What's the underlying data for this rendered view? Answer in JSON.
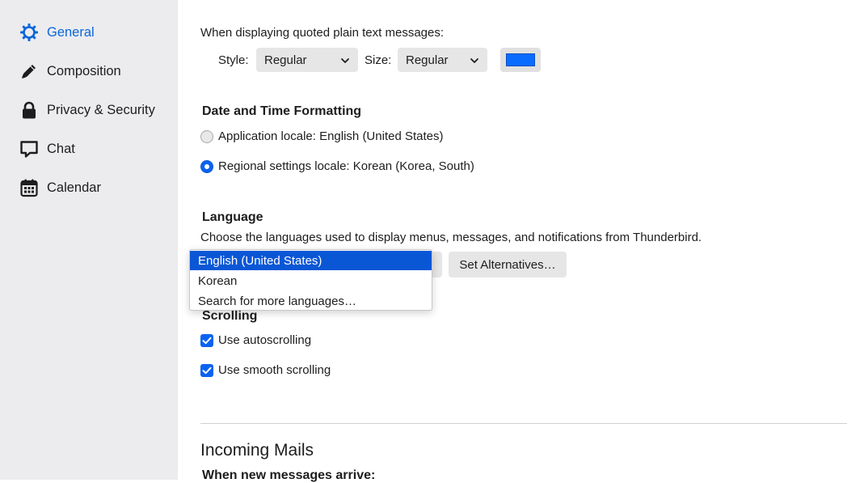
{
  "sidebar": {
    "items": [
      {
        "label": "General",
        "icon": "gear-icon",
        "active": true
      },
      {
        "label": "Composition",
        "icon": "pencil-icon"
      },
      {
        "label": "Privacy & Security",
        "icon": "lock-icon"
      },
      {
        "label": "Chat",
        "icon": "chat-bubble-icon"
      },
      {
        "label": "Calendar",
        "icon": "calendar-icon"
      }
    ]
  },
  "quoted": {
    "label": "When displaying quoted plain text messages:",
    "style_label": "Style:",
    "style_value": "Regular",
    "size_label": "Size:",
    "size_value": "Regular",
    "color": "#0a6cff"
  },
  "datetime": {
    "heading": "Date and Time Formatting",
    "option_app": "Application locale: English (United States)",
    "option_regional": "Regional settings locale: Korean (Korea, South)",
    "selected": "regional"
  },
  "language": {
    "heading": "Language",
    "description": "Choose the languages used to display menus, messages, and notifications from Thunderbird.",
    "set_alternatives": "Set Alternatives…",
    "dropdown": {
      "options": [
        "English (United States)",
        "Korean",
        "Search for more languages…"
      ],
      "selected": "English (United States)"
    }
  },
  "scrolling": {
    "heading": "Scrolling",
    "autoscroll": "Use autoscrolling",
    "smooth": "Use smooth scrolling",
    "autoscroll_checked": true,
    "smooth_checked": true
  },
  "incoming": {
    "title": "Incoming Mails",
    "subheading": "When new messages arrive:"
  },
  "colors": {
    "accent": "#0a63f0",
    "sidebar_bg": "#ececef",
    "selected_item": "#0a57d6"
  }
}
